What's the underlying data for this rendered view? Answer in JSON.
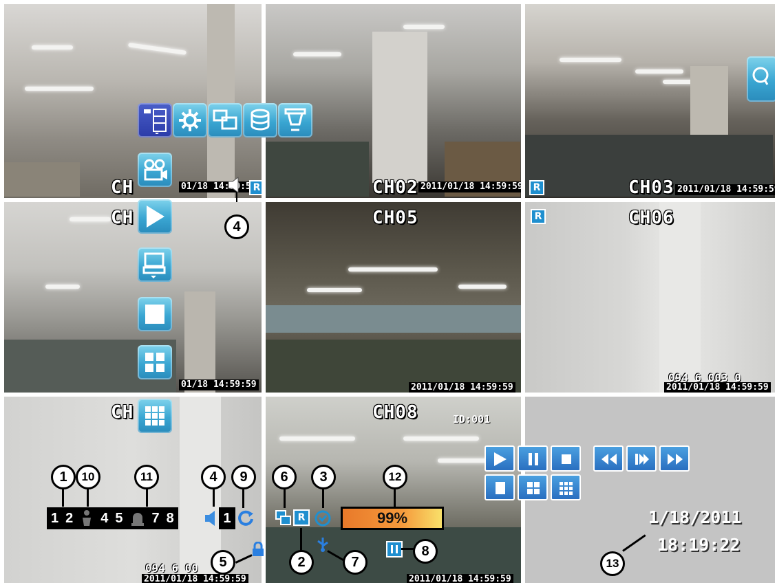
{
  "channels": {
    "ch1": {
      "label": "CH",
      "timestamp": "01/18 14:59:59"
    },
    "ch2": {
      "label": "CH02",
      "timestamp": "2011/01/18 14:59:59"
    },
    "ch3": {
      "label": "CH03",
      "timestamp": "2011/01/18 14:59:59"
    },
    "ch4": {
      "label": "CH",
      "timestamp": "01/18 14:59:59"
    },
    "ch5": {
      "label": "CH05",
      "timestamp": "2011/01/18 14:59:59"
    },
    "ch6": {
      "label": "CH06",
      "coords": "094 6 003 0",
      "timestamp": "2011/01/18 14:59:59"
    },
    "ch7": {
      "label": "CH",
      "coords": "094 6 00",
      "timestamp": "2011/01/18 14:59:59"
    },
    "ch8": {
      "label": "CH08",
      "id": "ID:001",
      "timestamp": "2011/01/18 14:59:59"
    }
  },
  "record_badge": "R",
  "channel_status": [
    "1",
    "2",
    "4",
    "5",
    "7",
    "8"
  ],
  "audio_channel": "1",
  "backup_progress": "99%",
  "clock": {
    "date": "1/18/2011",
    "time": "18:19:22"
  },
  "callouts": [
    "1",
    "10",
    "11",
    "4",
    "9",
    "6",
    "3",
    "12",
    "2",
    "7",
    "8",
    "5",
    "13",
    "4"
  ],
  "menu_icons": [
    "system-tree-icon",
    "settings-gear-icon",
    "display-icon",
    "storage-disk-icon",
    "camera-ptz-icon",
    "video-camera-icon",
    "playback-icon",
    "backup-icon",
    "single-view-icon",
    "quad-view-icon",
    "nine-view-icon"
  ],
  "colors": {
    "accent": "#3aa6d2",
    "active": "#2b3ba8",
    "record": "#1f8fcf",
    "progress": "#f59a3c"
  }
}
